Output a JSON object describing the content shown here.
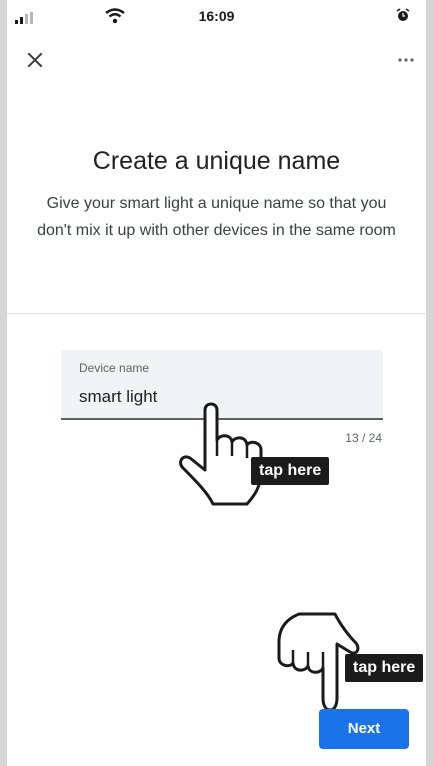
{
  "status_bar": {
    "time": "16:09",
    "signal_icon": "cellular-signal-icon",
    "wifi_icon": "wifi-icon",
    "alarm_icon": "alarm-clock-icon"
  },
  "top_bar": {
    "close_icon": "close-icon",
    "more_icon": "more-options-icon"
  },
  "header": {
    "title": "Create a unique name",
    "description": "Give your smart light a unique name so that you don't mix it up with other devices in the same room"
  },
  "name_field": {
    "label": "Device name",
    "value": "smart light",
    "counter": "13 / 24"
  },
  "annotations": {
    "tap_field": "tap here",
    "tap_next": "tap here",
    "hand_icon": "pointing-hand-icon"
  },
  "footer": {
    "next_label": "Next"
  },
  "colors": {
    "primary": "#1a73e8",
    "tooltip_bg": "#1b1b1b",
    "field_bg": "#f1f3f4"
  }
}
